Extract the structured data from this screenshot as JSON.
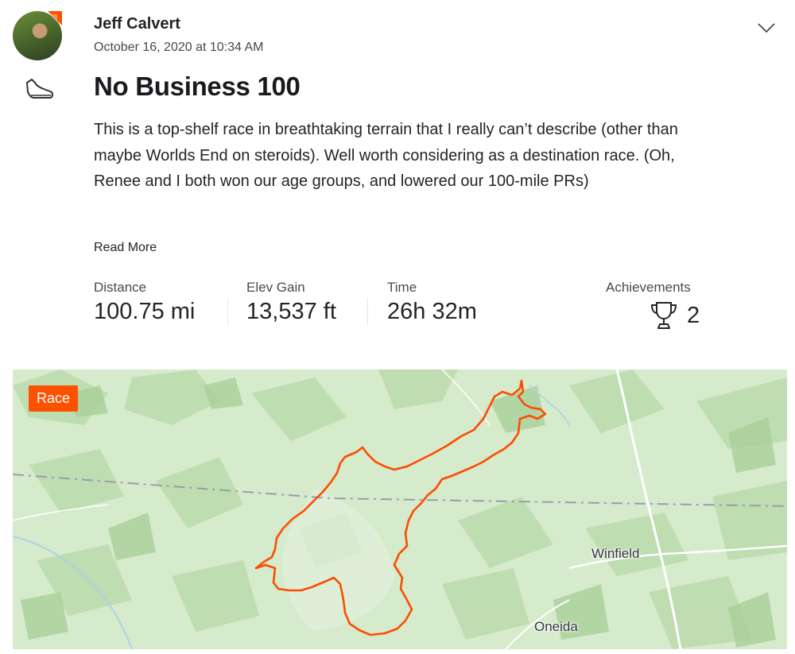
{
  "post": {
    "author": "Jeff Calvert",
    "date": "October 16, 2020 at 10:34 AM",
    "activity_icon": "shoe-icon",
    "title": "No Business 100",
    "description": "This is a top-shelf race in breathtaking terrain that I really can’t describe (other than maybe Worlds End on steroids). Well worth considering as a destination race. (Oh, Renee and I both won our age groups, and lowered our 100-mile PRs)",
    "read_more": "Read More"
  },
  "stats": {
    "distance": {
      "label": "Distance",
      "value": "100.75 mi"
    },
    "elev_gain": {
      "label": "Elev Gain",
      "value": "13,537 ft"
    },
    "time": {
      "label": "Time",
      "value": "26h 32m"
    },
    "achievements": {
      "label": "Achievements",
      "value": "2",
      "icon": "trophy-icon"
    }
  },
  "map": {
    "badge": "Race",
    "places": {
      "winfield": "Winfield",
      "oneida": "Oneida"
    },
    "route_color": "#fc4c02"
  },
  "colors": {
    "brand": "#fc5200",
    "text_primary": "#242428",
    "text_secondary": "#494950"
  }
}
